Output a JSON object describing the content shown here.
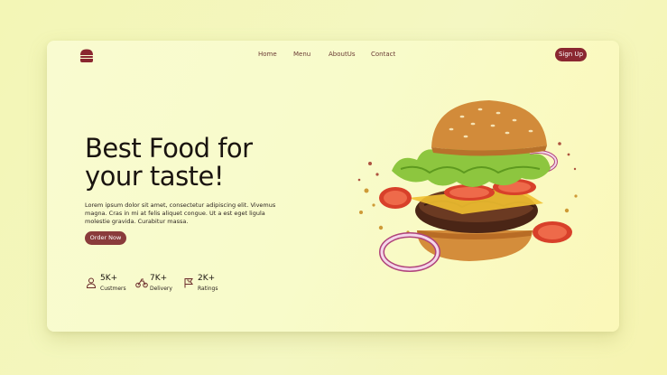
{
  "nav": {
    "items": [
      {
        "label": "Home"
      },
      {
        "label": "Menu"
      },
      {
        "label": "AboutUs"
      },
      {
        "label": "Contact"
      }
    ],
    "signup_label": "Sign Up"
  },
  "hero": {
    "title_line1": "Best Food for",
    "title_line2": "your taste!",
    "description": "Lorem ipsum dolor sit amet, consectetur adipiscing elit. Vivemus magna. Cras in mi at felis aliquet congue. Ut a est eget ligula molestie gravida. Curabitur massa.",
    "cta_label": "Order Now"
  },
  "stats": [
    {
      "value": "5K+",
      "label": "Custmers",
      "icon": "user-icon"
    },
    {
      "value": "7K+",
      "label": "Delivery",
      "icon": "bike-icon"
    },
    {
      "value": "2K+",
      "label": "Ratings",
      "icon": "flag-icon"
    }
  ],
  "colors": {
    "accent": "#8a2730",
    "button": "#8a3b3b",
    "background": "#f4f7c2",
    "text": "#1a1410"
  },
  "icons": {
    "logo": "burger-logo-icon",
    "hero_image": "burger-image"
  }
}
